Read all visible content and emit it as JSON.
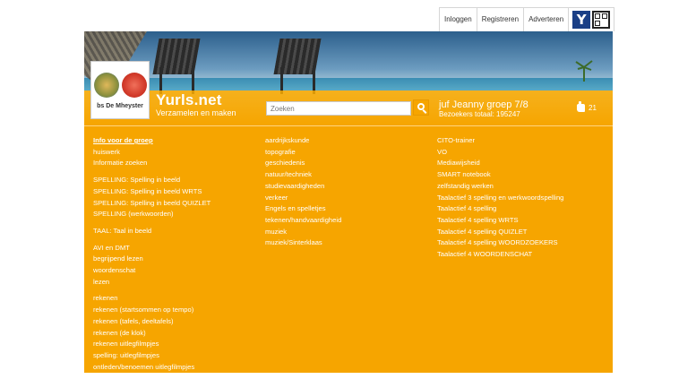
{
  "topnav": {
    "login": "Inloggen",
    "register": "Registreren",
    "advertise": "Adverteren",
    "y_button": "Y",
    "qr_icon": "qr-code-icon"
  },
  "header": {
    "logo_caption": "bs De Mheyster",
    "brand_name": "Yurls.net",
    "brand_tagline": "Verzamelen en maken",
    "search_placeholder": "Zoeken",
    "group_name": "juf Jeanny groep 7/8",
    "visitors": "Bezoekers totaal: 195247",
    "likes": "21",
    "accent_color": "#f6a500"
  },
  "columns": {
    "col1": [
      [
        "Info voor de groep",
        "huiswerk",
        "Informatie zoeken"
      ],
      [
        "SPELLING: Spelling in beeld",
        "SPELLING: Spelling in beeld WRTS",
        "SPELLING: Spelling in beeld QUIZLET",
        "SPELLING (werkwoorden)"
      ],
      [
        "TAAL: Taal in beeld"
      ],
      [
        "AVI en DMT",
        "begrijpend lezen",
        "woordenschat",
        "lezen"
      ],
      [
        "rekenen",
        "rekenen (startsommen op tempo)",
        "rekenen (tafels, deeltafels)",
        "rekenen (de klok)",
        "rekenen uitlegfilmpjes",
        "spelling: uitlegfilmpjes",
        "ontleden/benoemen uitlegfilmpjes"
      ]
    ],
    "col2": [
      "aardrijkskunde",
      "topografie",
      "geschiedenis",
      "natuur/techniek",
      "studievaardigheden",
      "verkeer",
      "Engels en spelletjes",
      "tekenen/handvaardigheid",
      "muziek",
      "muziek/Sinterklaas"
    ],
    "col3": [
      "CITO-trainer",
      "VO",
      "Mediawijsheid",
      "SMART notebook",
      "zelfstandig werken",
      "Taalactief 3 spelling en werkwoordspelling",
      "Taalactief 4 spelling",
      "Taalactief 4 spelling WRTS",
      "Taalactief 4 spelling QUIZLET",
      "Taalactief 4 spelling WOORDZOEKERS",
      "Taalactief 4 WOORDENSCHAT"
    ]
  }
}
